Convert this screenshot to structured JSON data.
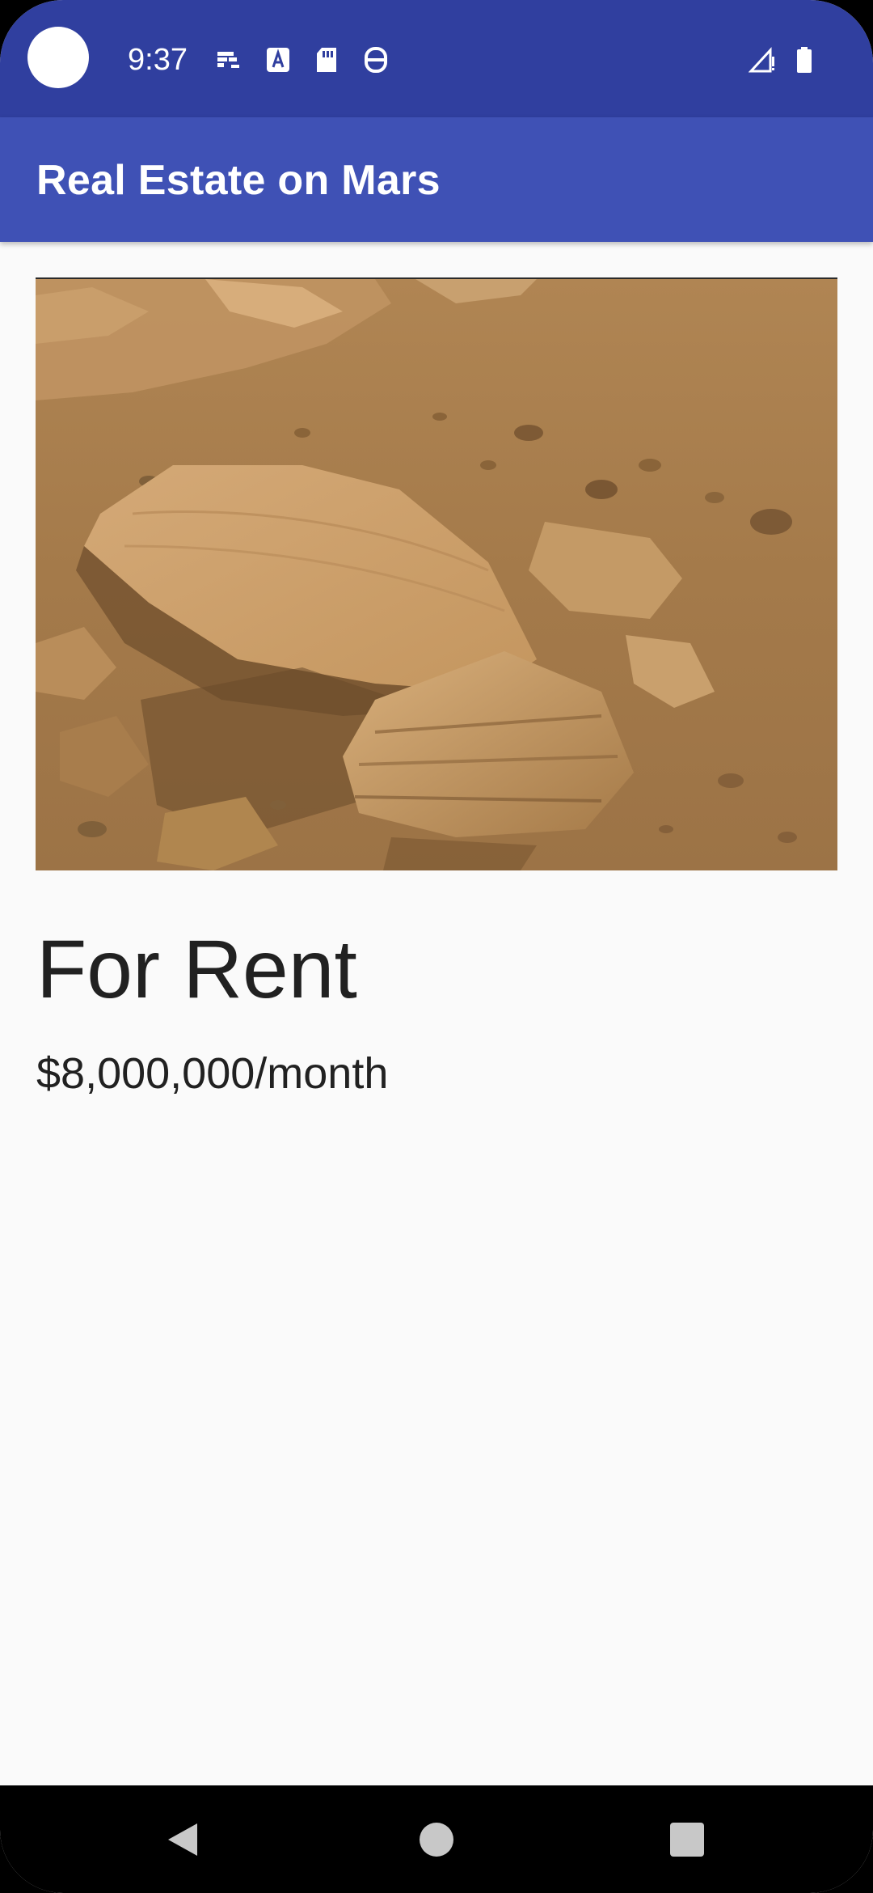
{
  "status_bar": {
    "time": "9:37",
    "icons": [
      "notification-icon",
      "font-a-icon",
      "sd-card-icon",
      "privacy-icon",
      "signal-icon",
      "battery-icon"
    ],
    "background_color": "#303f9f"
  },
  "app_bar": {
    "title": "Real Estate on Mars",
    "background_color": "#3f51b5"
  },
  "listing": {
    "type": "For Rent",
    "price": "$8,000,000/month"
  },
  "nav_bar": {
    "buttons": [
      "back-icon",
      "home-icon",
      "recents-icon"
    ]
  }
}
